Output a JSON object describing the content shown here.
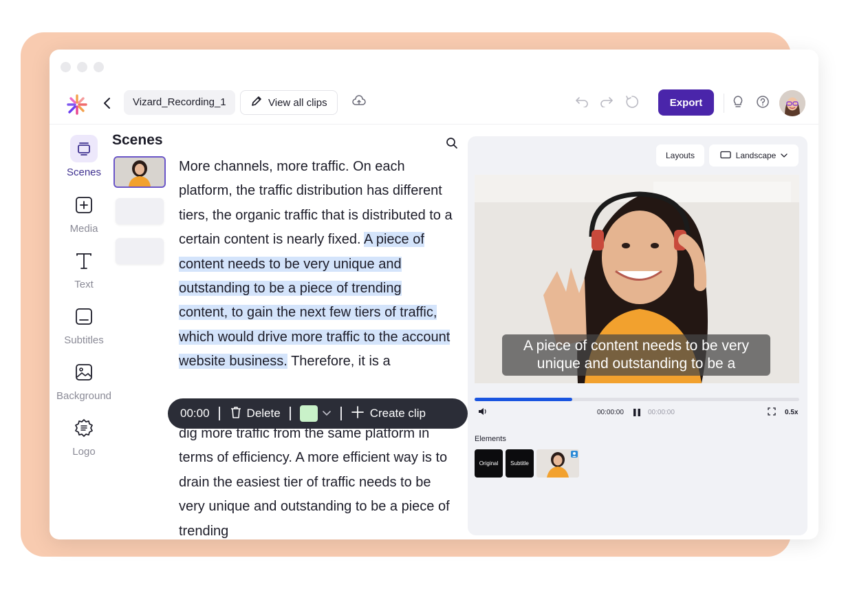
{
  "toolbar": {
    "file_name": "Vizard_Recording_1",
    "view_clips_label": "View all clips",
    "export_label": "Export"
  },
  "nav": {
    "items": [
      {
        "label": "Scenes",
        "icon": "layers-icon",
        "active": true
      },
      {
        "label": "Media",
        "icon": "plus-square-icon"
      },
      {
        "label": "Text",
        "icon": "text-icon"
      },
      {
        "label": "Subtitles",
        "icon": "subtitles-icon"
      },
      {
        "label": "Background",
        "icon": "image-icon"
      },
      {
        "label": "Logo",
        "icon": "badge-icon"
      }
    ]
  },
  "scenes": {
    "title": "Scenes"
  },
  "transcript": {
    "before_highlight": "More channels, more traffic. On each platform, the traffic distribution has different tiers, the organic traffic that is distributed to a certain content is nearly fixed. ",
    "highlight": "A piece of content needs to be very unique and outstanding to be a piece of trending content, to gain the next few tiers of traffic, which would drive more traffic to the account website business.",
    "after_highlight": " Therefore, it is a",
    "continuation": "dig more traffic from the same platform in terms of efficiency. A more efficient way is to drain the easiest tier of traffic needs to be very unique and outstanding to be a piece of trending"
  },
  "clip_bar": {
    "time": "00:00",
    "delete_label": "Delete",
    "create_label": "Create clip",
    "swatch_color": "#c9f2c9"
  },
  "preview": {
    "layouts_label": "Layouts",
    "orientation_label": "Landscape",
    "subtitle_text": "A piece of content needs to be very unique and outstanding to be a",
    "current_time": "00:00:00",
    "end_time": "00:00:00",
    "speed": "0.5x",
    "progress": 0.3,
    "elements_label": "Elements",
    "elements": [
      {
        "label": "Original"
      },
      {
        "label": "Subtitle"
      }
    ]
  },
  "colors": {
    "accent": "#4a25aa",
    "highlight": "#d4e4fb",
    "progress": "#1a55e0"
  }
}
